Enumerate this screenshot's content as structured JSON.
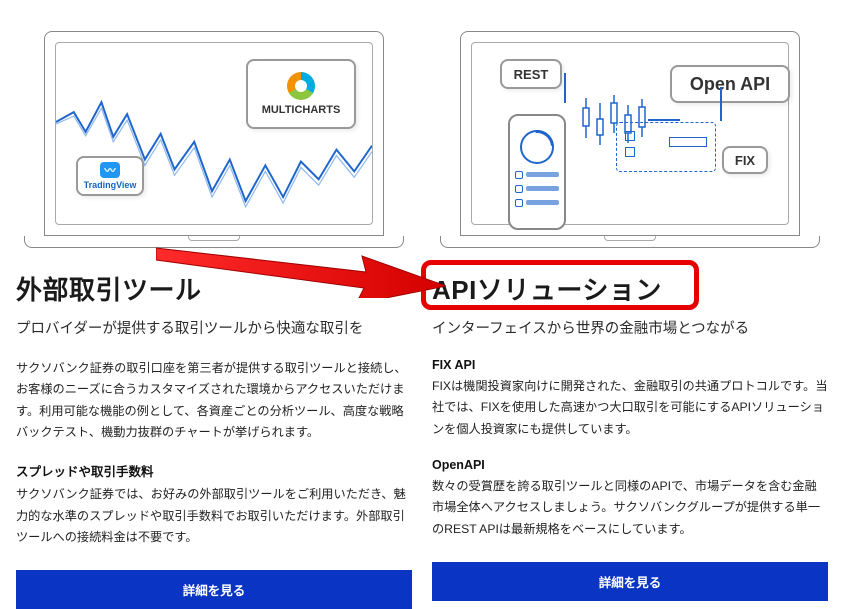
{
  "left": {
    "chip_big_label": "MULTICHARTS",
    "chip_small_label": "TradingView",
    "title": "外部取引ツール",
    "subtitle": "プロバイダーが提供する取引ツールから快適な取引を",
    "body1": "サクソバンク証券の取引口座を第三者が提供する取引ツールと接続し、お客様のニーズに合うカスタマイズされた環境からアクセスいただけます。利用可能な機能の例として、各資産ごとの分析ツール、高度な戦略バックテスト、機動力抜群のチャートが挙げられます。",
    "section2_head": "スプレッドや取引手数料",
    "body2": "サクソバンク証券では、お好みの外部取引ツールをご利用いただき、魅力的な水準のスプレッドや取引手数料でお取引いただけます。外部取引ツールへの接続料金は不要です。",
    "button": "詳細を見る"
  },
  "right": {
    "rest_label": "REST",
    "openapi_label": "Open API",
    "fix_label": "FIX",
    "title": "APIソリューション",
    "subtitle": "インターフェイスから世界の金融市場とつながる",
    "section1_head": "FIX API",
    "body1": "FIXは機関投資家向けに開発された、金融取引の共通プロトコルです。当社では、FIXを使用した高速かつ大口取引を可能にするAPIソリューションを個人投資家にも提供しています。",
    "section2_head": "OpenAPI",
    "body2": "数々の受賞歴を誇る取引ツールと同様のAPIで、市場データを含む金融市場全体へアクセスしましょう。サクソバンクグループが提供する単一のREST APIは最新規格をベースにしています。",
    "button": "詳細を見る"
  }
}
